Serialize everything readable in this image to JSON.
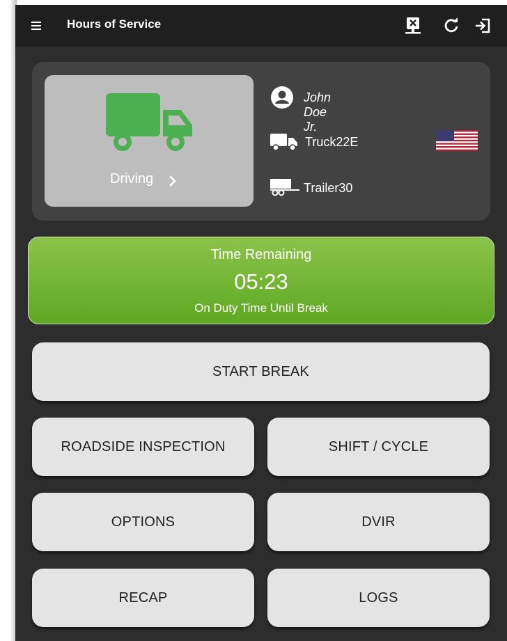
{
  "app": {
    "title": "Hours of Service"
  },
  "toolbar_icons": [
    "menu-icon",
    "disconnected-device-icon",
    "refresh-icon",
    "logout-icon"
  ],
  "driver_card": {
    "status_label": "Driving",
    "driver_name": "John Doe Jr.",
    "truck": "Truck22E",
    "trailer": "Trailer30",
    "status_color": "#4caf50",
    "flag": "us-flag-icon"
  },
  "time_remaining": {
    "title": "Time Remaining",
    "value": "05:23",
    "subtitle": "On Duty Time Until Break",
    "color": "#7cb342"
  },
  "buttons": {
    "start_break": "START BREAK",
    "roadside_inspection": "ROADSIDE INSPECTION",
    "shift_cycle": "SHIFT / CYCLE",
    "options": "OPTIONS",
    "dvir": "DVIR",
    "recap": "RECAP",
    "logs": "LOGS"
  }
}
